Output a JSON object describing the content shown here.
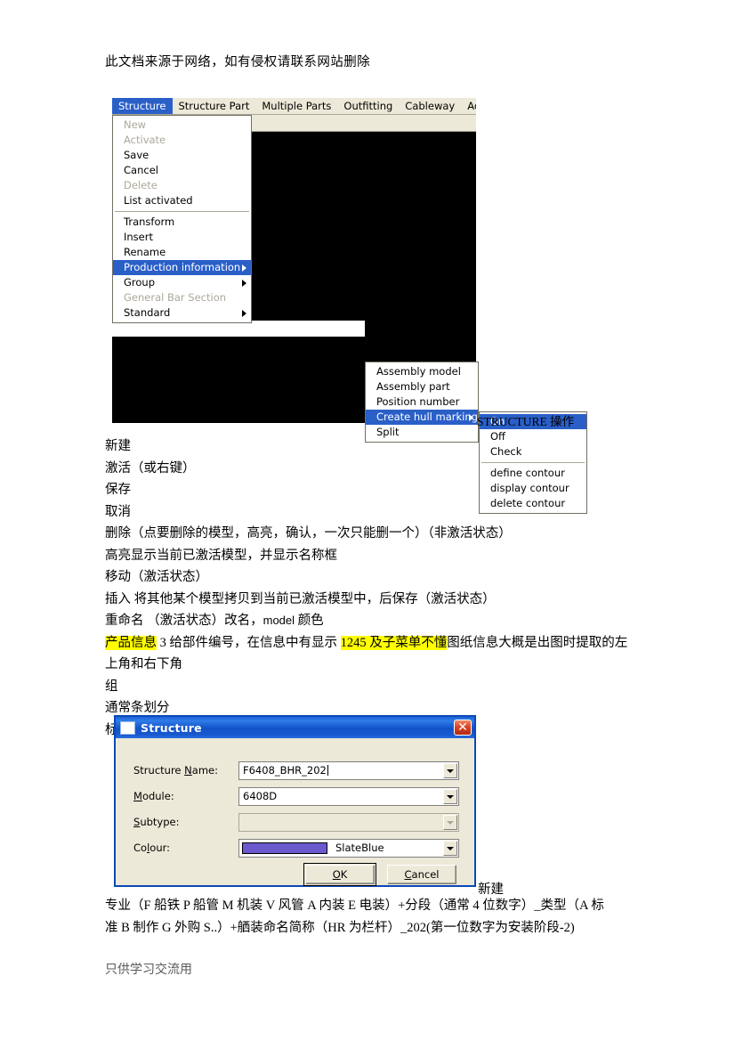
{
  "document": {
    "header_note": "此文档来源于网络，如有侵权请联系网站删除",
    "footer_note": "只供学习交流用"
  },
  "screenshot_menu": {
    "menubar": {
      "items": [
        {
          "label": "Structure",
          "active": true
        },
        {
          "label": "Structure Part",
          "active": false
        },
        {
          "label": "Multiple Parts",
          "active": false
        },
        {
          "label": "Outfitting",
          "active": false
        },
        {
          "label": "Cableway",
          "active": false
        },
        {
          "label": "Accommoda",
          "active": false
        }
      ]
    },
    "structure_menu": {
      "items": [
        {
          "label": "New",
          "state": "disabled"
        },
        {
          "label": "Activate",
          "state": "disabled"
        },
        {
          "label": "Save",
          "state": "normal"
        },
        {
          "label": "Cancel",
          "state": "normal"
        },
        {
          "label": "Delete",
          "state": "disabled"
        },
        {
          "label": "List activated",
          "state": "normal"
        },
        {
          "label": "__separator__",
          "state": "separator"
        },
        {
          "label": "Transform",
          "state": "normal"
        },
        {
          "label": "Insert",
          "state": "normal"
        },
        {
          "label": "Rename",
          "state": "normal"
        },
        {
          "label": "Production information",
          "state": "selected",
          "submenu": true
        },
        {
          "label": "Group",
          "state": "normal",
          "submenu": true
        },
        {
          "label": "General Bar Section",
          "state": "disabled"
        },
        {
          "label": "Standard",
          "state": "normal",
          "submenu": true
        }
      ]
    },
    "production_information_menu": {
      "items": [
        {
          "label": "Assembly model",
          "state": "normal"
        },
        {
          "label": "Assembly part",
          "state": "normal"
        },
        {
          "label": "Position number",
          "state": "normal"
        },
        {
          "label": "Create hull marking",
          "state": "selected",
          "submenu": true
        },
        {
          "label": "Split",
          "state": "normal"
        }
      ]
    },
    "create_hull_marking_menu": {
      "items": [
        {
          "label": "On",
          "state": "selected"
        },
        {
          "label": "Off",
          "state": "normal"
        },
        {
          "label": "Check",
          "state": "normal"
        },
        {
          "label": "__separator__",
          "state": "separator"
        },
        {
          "label": "define contour",
          "state": "normal"
        },
        {
          "label": "display contour",
          "state": "normal"
        },
        {
          "label": "delete contour",
          "state": "normal"
        }
      ]
    },
    "caption": "STRUCTURE 操作"
  },
  "notes": {
    "lines": [
      "新建",
      "激活（或右键）",
      "保存",
      "取消",
      "删除（点要删除的模型，高亮，确认，一次只能删一个）（非激活状态）",
      "高亮显示当前已激活模型，并显示名称框",
      "移动（激活状态）",
      "插入 将其他某个模型拷贝到当前已激活模型中，后保存（激活状态）"
    ],
    "rename_line_prefix": "重命名 （激活状态）改名，",
    "rename_line_latin": "model",
    "rename_line_suffix": " 颜色",
    "product_info_hl1": "产品信息",
    "product_info_mid1": "  3 给部件编号，在信息中有显示 ",
    "product_info_hl2": "1245 及子菜单不懂",
    "product_info_tail": "图纸信息大概是出图时提取的左上角和右下角",
    "tail_lines": [
      "组",
      "通常条划分",
      "标准"
    ]
  },
  "structure_dialog": {
    "title": "Structure",
    "close_glyph": "✕",
    "fields": [
      {
        "label_pre": "Structure ",
        "label_accel": "N",
        "label_post": "ame:",
        "value": "F6408_BHR_202",
        "enabled": true,
        "cursor": true
      },
      {
        "label_pre": "",
        "label_accel": "M",
        "label_post": "odule:",
        "value": "6408D",
        "enabled": true,
        "cursor": false
      },
      {
        "label_pre": "",
        "label_accel": "S",
        "label_post": "ubtype:",
        "value": "",
        "enabled": false,
        "cursor": false
      }
    ],
    "colour_field": {
      "label_pre": "Co",
      "label_accel": "l",
      "label_post": "our:",
      "swatch_hex": "#6a5acd",
      "value": "SlateBlue"
    },
    "buttons": {
      "ok_pre": "",
      "ok_accel": "O",
      "ok_post": "K",
      "cancel_pre": "",
      "cancel_accel": "C",
      "cancel_post": "ancel"
    },
    "caption": "新建"
  },
  "naming_rule": {
    "line1": "专业（F 船铁 P 船管 M 机装 V 风管 A 内装 E 电装）+分段（通常 4 位数字）_类型（A 标",
    "line2": "准 B 制作 G 外购 S..）+舾装命名简称（HR 为栏杆）_202(第一位数字为安装阶段-2)"
  },
  "colors": {
    "menu_highlight": "#2a5fc8",
    "menu_face": "#ece9d8",
    "title_blue": "#1252c8",
    "highlight_yellow": "#ffff00",
    "slate_blue": "#6a5acd"
  }
}
